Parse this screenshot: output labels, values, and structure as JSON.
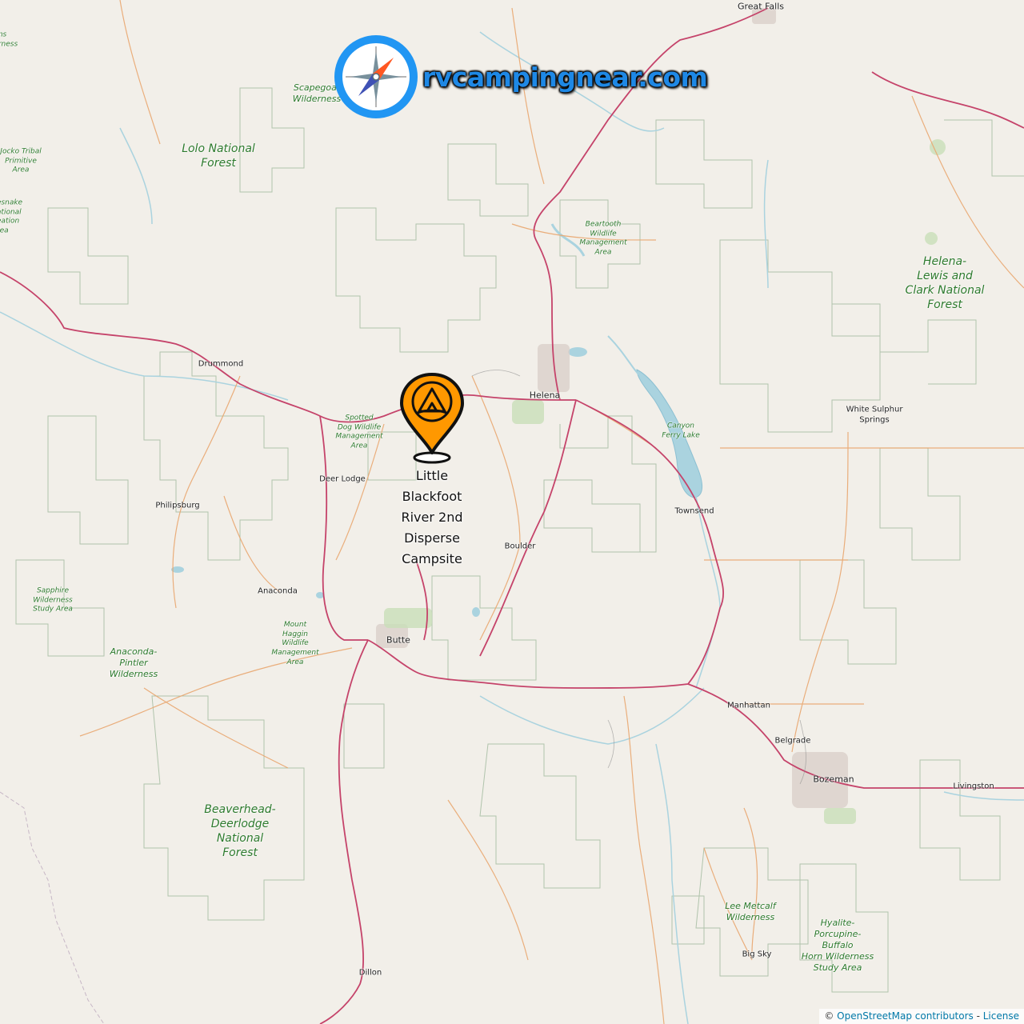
{
  "logo": {
    "text": "rvcampingnear.com",
    "icon": "compass-icon"
  },
  "marker": {
    "icon": "tent-pin-icon",
    "color": "#ff9800",
    "label_lines": [
      "Little",
      "Blackfoot",
      "River 2nd",
      "Disperse",
      "Campsite"
    ]
  },
  "places": {
    "great_falls": "Great Falls",
    "drummond": "Drummond",
    "helena": "Helena",
    "white_sulphur_springs_1": "White Sulphur",
    "white_sulphur_springs_2": "Springs",
    "deer_lodge": "Deer Lodge",
    "philipsburg": "Philipsburg",
    "townsend": "Townsend",
    "boulder": "Boulder",
    "anaconda": "Anaconda",
    "butte": "Butte",
    "manhattan": "Manhattan",
    "belgrade": "Belgrade",
    "bozeman": "Bozeman",
    "livingston": "Livingston",
    "big_sky": "Big Sky",
    "dillon": "Dillon"
  },
  "parks": {
    "lolo": "Lolo National\nForest",
    "scapegoat": "Scapegoat\nWilderness",
    "jocko": "Jocko Tribal\nPrimitive\nArea",
    "rattlesnake": "esnake\national\neation\nrea",
    "wilderness_edge": "ns\nrness",
    "beartooth": "Beartooth\nWildlife\nManagement\nArea",
    "helena_lewis_clark": "Helena-\nLewis and\nClark National\nForest",
    "spotted_dog": "Spotted\nDog Wildlife\nManagement\nArea",
    "canyon_ferry": "Canyon\nFerry Lake",
    "sapphire": "Sapphire\nWilderness\nStudy Area",
    "mount_haggin": "Mount\nHaggin\nWildlife\nManagement\nArea",
    "anaconda_pintler": "Anaconda-\nPintler\nWilderness",
    "beaverhead": "Beaverhead-\nDeerlodge\nNational\nForest",
    "lee_metcalf": "Lee Metcalf\nWilderness",
    "hyalite": "Hyalite-\nPorcupine-\nBuffalo\nHorn Wilderness\nStudy Area"
  },
  "attribution": {
    "prefix": "© ",
    "link1": "OpenStreetMap contributors",
    "sep": " - ",
    "link2": "License"
  },
  "colors": {
    "land": "#f2efe9",
    "park_green": "#2d7a2d",
    "boundary": "#9cb09c",
    "motorway": "#c23b5b",
    "primary": "#e8a06b",
    "water": "#aad3df",
    "logo_blue": "#1e88e5",
    "compass_ring": "#2196f3"
  }
}
